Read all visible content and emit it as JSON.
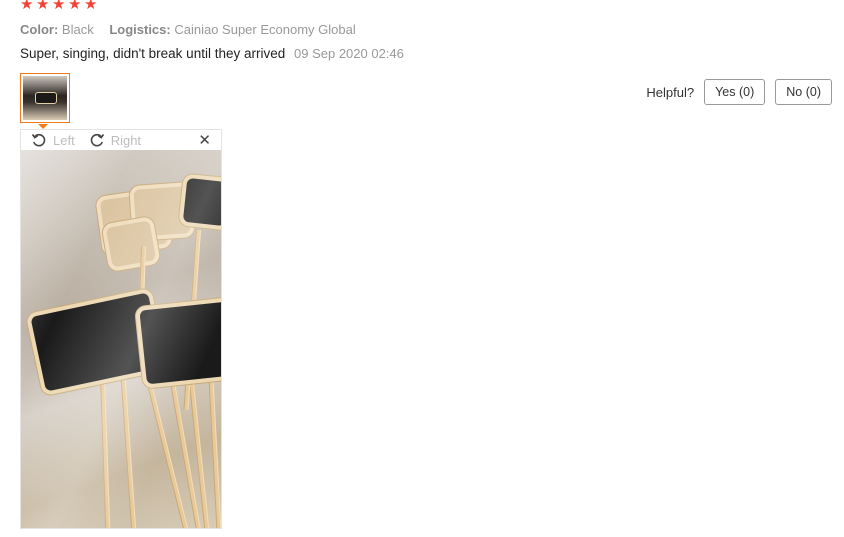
{
  "rating": {
    "stars": 5,
    "color": "#f44336"
  },
  "meta": {
    "color_label": "Color:",
    "color_value": "Black",
    "logistics_label": "Logistics:",
    "logistics_value": "Cainiao Super Economy Global"
  },
  "review": {
    "text": "Super, singing, didn't break until they arrived",
    "date": "09 Sep 2020 02:46"
  },
  "helpful": {
    "label": "Helpful?",
    "yes_label": "Yes (0)",
    "no_label": "No (0)"
  },
  "viewer": {
    "rotate_left_label": "Left",
    "rotate_right_label": "Right",
    "close_glyph": "✕"
  },
  "colors": {
    "accent": "#f47a20"
  }
}
